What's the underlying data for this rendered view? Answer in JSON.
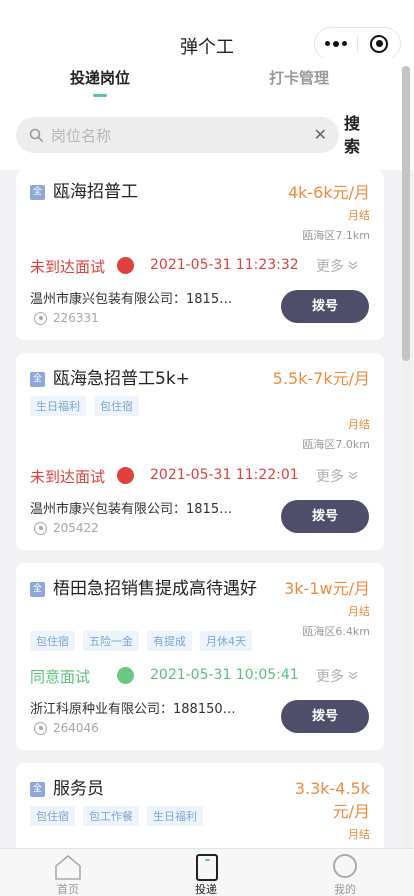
{
  "header": {
    "title": "弹个工"
  },
  "tabs": [
    {
      "label": "投递岗位",
      "active": true
    },
    {
      "label": "打卡管理",
      "active": false
    }
  ],
  "search": {
    "placeholder": "岗位名称",
    "clear_icon": "close-icon",
    "button_label": "搜索"
  },
  "jobs": [
    {
      "badge": "全",
      "title": "瓯海招普工",
      "salary": "4k-6k元/月",
      "pay_cycle": "月结",
      "district": "瓯海区7.1km",
      "tags": [],
      "status": "未到达面试",
      "status_color": "#e0413c",
      "status_time": "2021-05-31 11:23:32",
      "more_label": "更多",
      "company": "温州市康兴包装有限公司：1815…",
      "views": "226331",
      "dial_label": "拨号"
    },
    {
      "badge": "全",
      "title": "瓯海急招普工5k+",
      "salary": "5.5k-7k元/月",
      "pay_cycle": "月结",
      "district": "瓯海区7.0km",
      "tags": [
        "生日福利",
        "包住宿"
      ],
      "status": "未到达面试",
      "status_color": "#e0413c",
      "status_time": "2021-05-31 11:22:01",
      "more_label": "更多",
      "company": "温州市康兴包装有限公司：1815…",
      "views": "205422",
      "dial_label": "拨号"
    },
    {
      "badge": "全",
      "title": "梧田急招销售提成高待遇好",
      "salary": "3k-1w元/月",
      "pay_cycle": "月结",
      "district": "瓯海区6.4km",
      "tags": [
        "包住宿",
        "五险一金",
        "有提成",
        "月休4天"
      ],
      "status": "同意面试",
      "status_color": "#5cbf7a",
      "status_time": "2021-05-31 10:05:41",
      "more_label": "更多",
      "company": "浙江科原种业有限公司：188150…",
      "views": "264046",
      "dial_label": "拨号"
    },
    {
      "badge": "全",
      "title": "服务员",
      "salary": "3.3k-4.5k元/月",
      "pay_cycle": "月结",
      "tags": [
        "包住宿",
        "包工作餐",
        "生日福利"
      ]
    }
  ],
  "bottom_nav": [
    {
      "label": "首页",
      "icon": "home-icon",
      "active": false
    },
    {
      "label": "投递",
      "icon": "deliver-icon",
      "active": true
    },
    {
      "label": "我的",
      "icon": "me-icon",
      "active": false
    }
  ],
  "colors": {
    "salary": "#f08b3d",
    "tab_indicator": "#5fc5a0",
    "dial_button": "#4e4e6a"
  }
}
